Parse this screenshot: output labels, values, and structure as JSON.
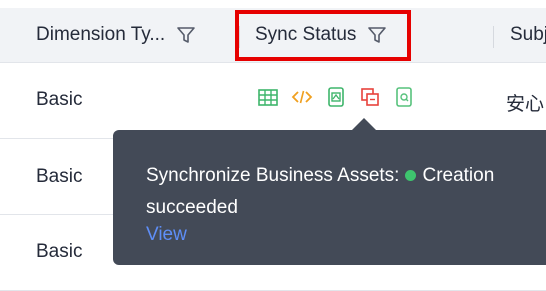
{
  "columns": {
    "dimension_type": "Dimension Ty...",
    "sync_status": "Sync Status",
    "subject_partial": "Subj"
  },
  "rows": [
    {
      "dimension_type": "Basic",
      "subject_partial": "安心"
    },
    {
      "dimension_type": "Basic"
    },
    {
      "dimension_type": "Basic"
    }
  ],
  "sync_icons": [
    "table-icon",
    "code-icon",
    "asset-icon",
    "copy-icon",
    "file-search-icon"
  ],
  "tooltip": {
    "label": "Synchronize Business Assets:",
    "status": "Creation",
    "status_cont": "succeeded",
    "link": "View"
  },
  "colors": {
    "header_bg": "#f1f3f6",
    "highlight": "#e60000",
    "tooltip_bg": "#434a57",
    "success": "#3ec46e",
    "link": "#5e8ef7"
  }
}
